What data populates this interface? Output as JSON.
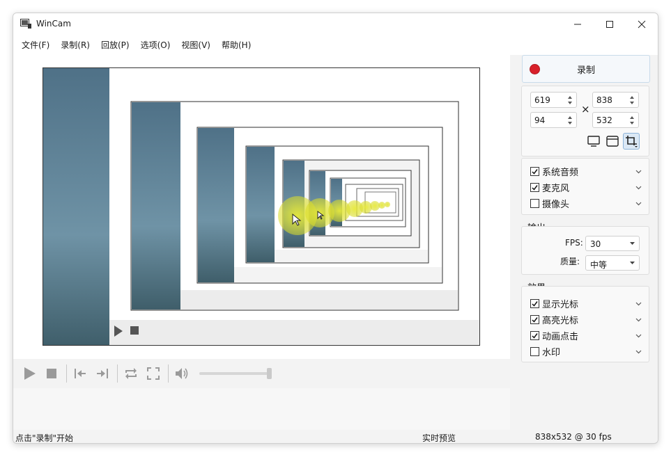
{
  "window": {
    "title": "WinCam"
  },
  "menu": [
    "文件(F)",
    "录制(R)",
    "回放(P)",
    "选项(O)",
    "视图(V)",
    "帮助(H)"
  ],
  "record": {
    "label": "录制"
  },
  "region": {
    "x": "619",
    "y": "94",
    "width": "838",
    "height": "532",
    "times": "×"
  },
  "audio": [
    {
      "label": "系统音频",
      "checked": true
    },
    {
      "label": "麦克风",
      "checked": true
    },
    {
      "label": "摄像头",
      "checked": false
    }
  ],
  "output": {
    "title": "输出",
    "fps_label": "FPS:",
    "fps_value": "30",
    "quality_label": "质量:",
    "quality_value": "中等"
  },
  "effects": {
    "title": "效果",
    "items": [
      {
        "label": "显示光标",
        "checked": true
      },
      {
        "label": "高亮光标",
        "checked": true
      },
      {
        "label": "动画点击",
        "checked": true
      },
      {
        "label": "水印",
        "checked": false
      }
    ]
  },
  "status": {
    "left": "点击\"录制\"开始",
    "center": "实时预览",
    "right": "838x532 @ 30 fps"
  },
  "icons": {
    "app": "wincam-app-icon",
    "monitor": "monitor-icon",
    "window": "window-icon",
    "crop": "crop-icon"
  },
  "colors": {
    "record": "#d8202a",
    "accent_border": "#c9dbea",
    "preview_bg": "#5b7f95"
  }
}
